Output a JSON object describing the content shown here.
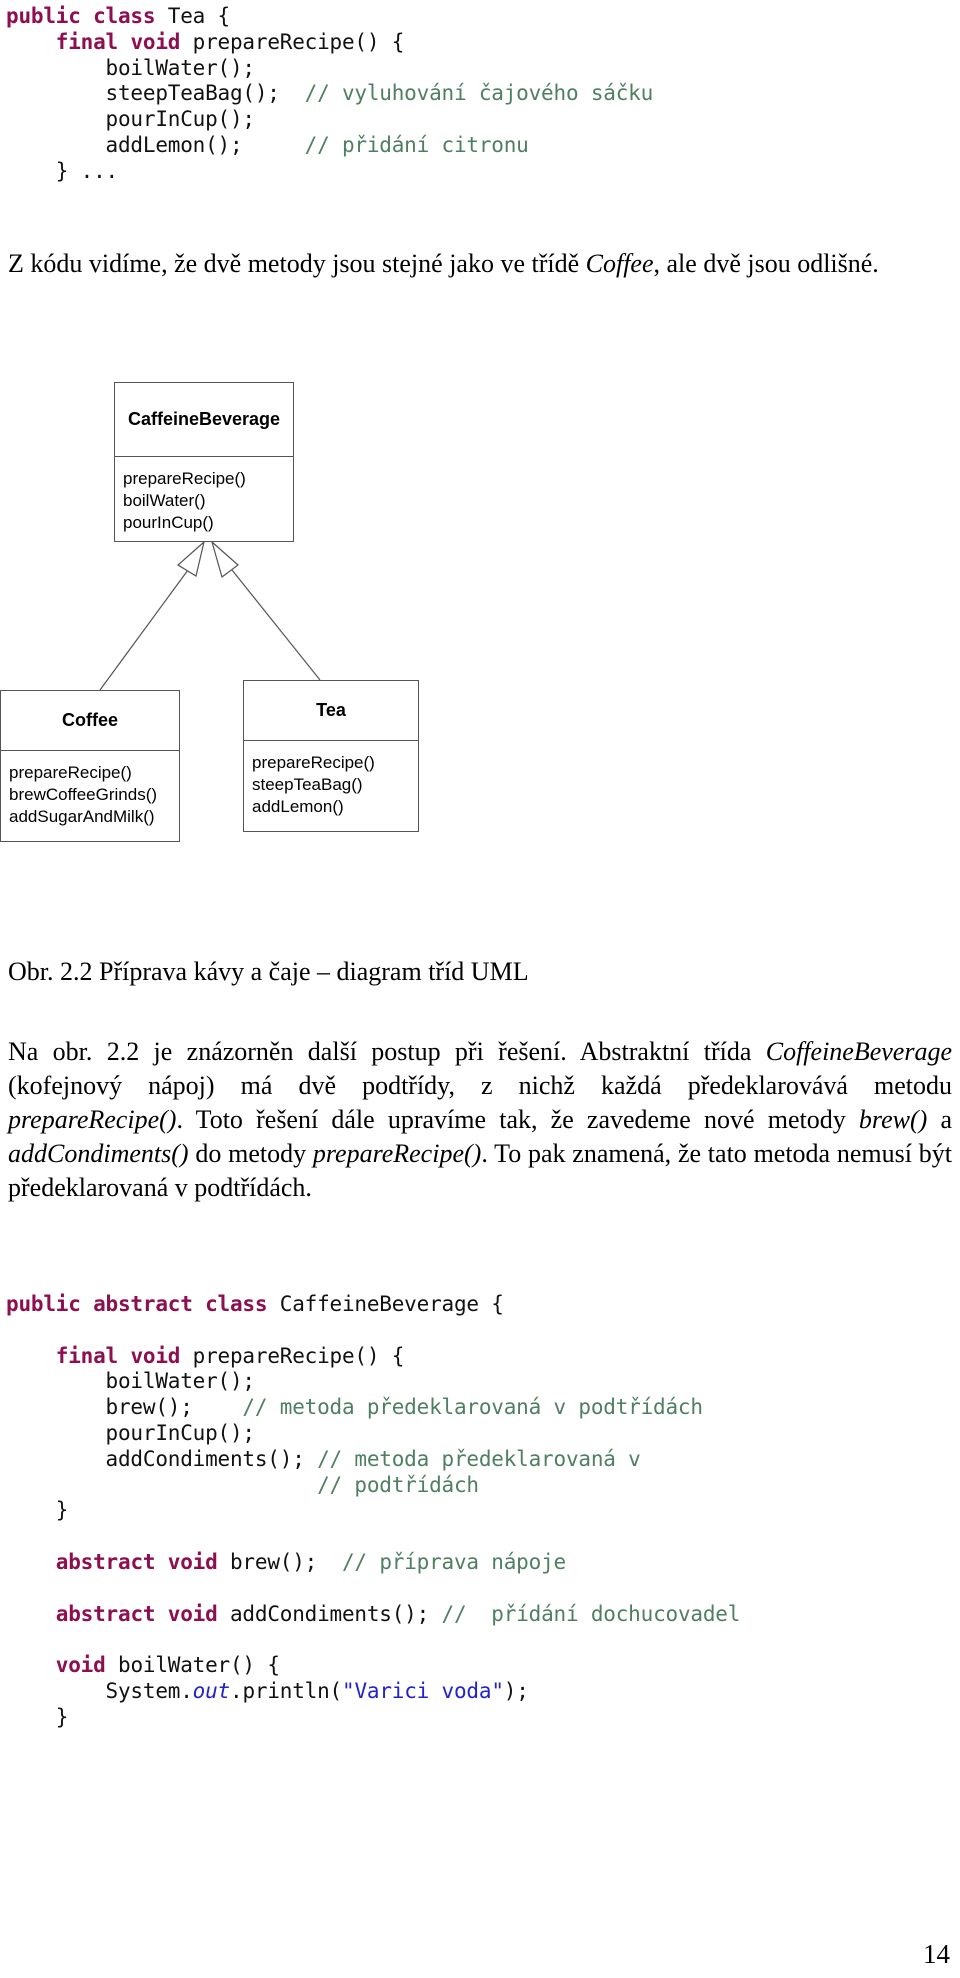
{
  "code_block_tea": {
    "name": "tea-class-source",
    "lines": [
      [
        {
          "t": "public class ",
          "c": "kw"
        },
        {
          "t": "Tea {",
          "c": "plain"
        }
      ],
      [
        {
          "t": "    ",
          "c": "plain"
        },
        {
          "t": "final void ",
          "c": "kw"
        },
        {
          "t": "prepareRecipe() {",
          "c": "plain"
        }
      ],
      [
        {
          "t": "        boilWater();",
          "c": "plain"
        }
      ],
      [
        {
          "t": "        steepTeaBag();  ",
          "c": "plain"
        },
        {
          "t": "// vyluhování čajového sáčku",
          "c": "cmt"
        }
      ],
      [
        {
          "t": "        pourInCup();",
          "c": "plain"
        }
      ],
      [
        {
          "t": "        addLemon();     ",
          "c": "plain"
        },
        {
          "t": "// přidání citronu",
          "c": "cmt"
        }
      ],
      [
        {
          "t": "    } ...",
          "c": "plain"
        }
      ]
    ]
  },
  "para_intro": {
    "name": "intro-paragraph",
    "segments": [
      {
        "t": "Z kódu vidíme, že dvě metody jsou stejné jako ve třídě ",
        "style": "normal"
      },
      {
        "t": "Coffee",
        "style": "italic"
      },
      {
        "t": ", ale dvě jsou odlišné.",
        "style": "normal"
      }
    ]
  },
  "uml": {
    "name": "uml-class-diagram",
    "boxes": [
      {
        "id": "caffeinebeverage",
        "title": "CaffeineBeverage",
        "members": [
          "prepareRecipe()",
          "boilWater()",
          "pourInCup()"
        ]
      },
      {
        "id": "coffee",
        "title": "Coffee",
        "members": [
          "prepareRecipe()",
          "brewCoffeeGrinds()",
          "addSugarAndMilk()"
        ]
      },
      {
        "id": "tea",
        "title": "Tea",
        "members": [
          "prepareRecipe()",
          "steepTeaBag()",
          "addLemon()"
        ]
      }
    ],
    "relations": [
      {
        "from": "coffee",
        "to": "caffeinebeverage",
        "kind": "generalization"
      },
      {
        "from": "tea",
        "to": "caffeinebeverage",
        "kind": "generalization"
      }
    ],
    "stroke_color": "#555555"
  },
  "figure_caption": {
    "name": "figure-caption",
    "text": "Obr. 2.2 Příprava kávy a čaje – diagram tříd UML"
  },
  "para_explain": {
    "name": "explanation-paragraph",
    "segments": [
      {
        "t": "Na obr. 2.2 je znázorněn další postup při řešení. Abstraktní třída ",
        "style": "normal"
      },
      {
        "t": "CoffeineBeverage",
        "style": "italic"
      },
      {
        "t": " (kofejnový nápoj) má dvě podtřídy, z nichž každá předeklarovává metodu ",
        "style": "normal"
      },
      {
        "t": "prepareRecipe()",
        "style": "italic"
      },
      {
        "t": ". Toto řešení dále upravíme tak, že zavedeme nové metody ",
        "style": "normal"
      },
      {
        "t": "brew()",
        "style": "italic"
      },
      {
        "t": " a ",
        "style": "normal"
      },
      {
        "t": "addCondiments()",
        "style": "italic"
      },
      {
        "t": " do metody ",
        "style": "normal"
      },
      {
        "t": "prepareRecipe()",
        "style": "italic"
      },
      {
        "t": ". To pak znamená, že tato metoda nemusí být předeklarovaná v podtřídách.",
        "style": "normal"
      }
    ]
  },
  "code_block_caffeine": {
    "name": "caffeinebeverage-class-source",
    "lines": [
      [
        {
          "t": "public abstract class ",
          "c": "kw"
        },
        {
          "t": "CaffeineBeverage {",
          "c": "plain"
        }
      ],
      [
        {
          "t": "",
          "c": "plain"
        }
      ],
      [
        {
          "t": "    ",
          "c": "plain"
        },
        {
          "t": "final void ",
          "c": "kw"
        },
        {
          "t": "prepareRecipe() {",
          "c": "plain"
        }
      ],
      [
        {
          "t": "        boilWater();",
          "c": "plain"
        }
      ],
      [
        {
          "t": "        brew();    ",
          "c": "plain"
        },
        {
          "t": "// metoda předeklarovaná v podtřídách",
          "c": "cmt"
        }
      ],
      [
        {
          "t": "        pourInCup();",
          "c": "plain"
        }
      ],
      [
        {
          "t": "        addCondiments(); ",
          "c": "plain"
        },
        {
          "t": "// metoda předeklarovaná v",
          "c": "cmt"
        }
      ],
      [
        {
          "t": "                         ",
          "c": "plain"
        },
        {
          "t": "// podtřídách",
          "c": "cmt"
        }
      ],
      [
        {
          "t": "    }",
          "c": "plain"
        }
      ],
      [
        {
          "t": "",
          "c": "plain"
        }
      ],
      [
        {
          "t": "    ",
          "c": "plain"
        },
        {
          "t": "abstract void ",
          "c": "kw"
        },
        {
          "t": "brew();  ",
          "c": "plain"
        },
        {
          "t": "// příprava nápoje",
          "c": "cmt"
        }
      ],
      [
        {
          "t": "",
          "c": "plain"
        }
      ],
      [
        {
          "t": "    ",
          "c": "plain"
        },
        {
          "t": "abstract void ",
          "c": "kw"
        },
        {
          "t": "addCondiments(); ",
          "c": "plain"
        },
        {
          "t": "//  přídání dochucovadel",
          "c": "cmt"
        }
      ],
      [
        {
          "t": "",
          "c": "plain"
        }
      ],
      [
        {
          "t": "    ",
          "c": "plain"
        },
        {
          "t": "void ",
          "c": "kw"
        },
        {
          "t": "boilWater() {",
          "c": "plain"
        }
      ],
      [
        {
          "t": "        System.",
          "c": "plain"
        },
        {
          "t": "out",
          "c": "fieldit"
        },
        {
          "t": ".println(",
          "c": "plain"
        },
        {
          "t": "\"Varici voda\"",
          "c": "str"
        },
        {
          "t": ");",
          "c": "plain"
        }
      ],
      [
        {
          "t": "    }",
          "c": "plain"
        }
      ]
    ]
  },
  "page_number": {
    "name": "page-number",
    "text": "14"
  },
  "colors": {
    "keyword": "#8e0f50",
    "comment": "#4f7f62",
    "string": "#2222cc",
    "diagram_stroke": "#555555",
    "text": "#000000"
  }
}
